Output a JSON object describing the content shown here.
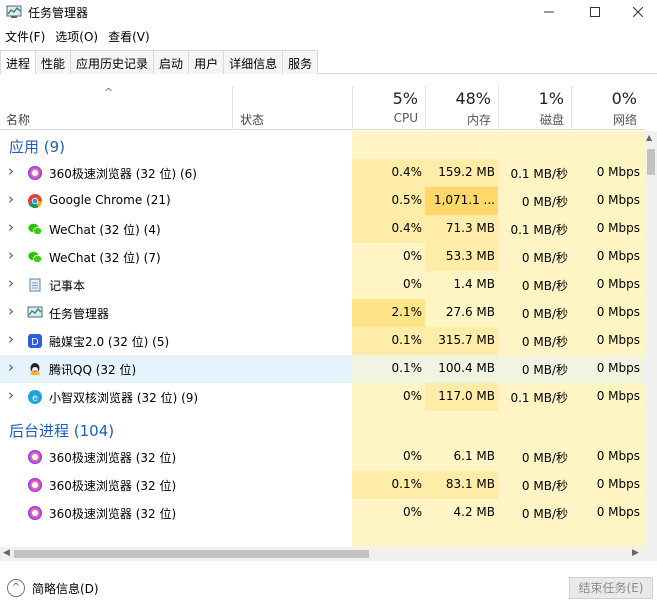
{
  "window": {
    "title": "任务管理器"
  },
  "menu": [
    "文件(F)",
    "选项(O)",
    "查看(V)"
  ],
  "tabs": [
    "进程",
    "性能",
    "应用历史记录",
    "启动",
    "用户",
    "详细信息",
    "服务"
  ],
  "header": {
    "name": "名称",
    "status": "状态",
    "cpu": {
      "pct": "5%",
      "label": "CPU"
    },
    "memory": {
      "pct": "48%",
      "label": "内存"
    },
    "disk": {
      "pct": "1%",
      "label": "磁盘"
    },
    "network": {
      "pct": "0%",
      "label": "网络"
    }
  },
  "groups": {
    "apps": "应用 (9)",
    "background": "后台进程 (104)"
  },
  "apps": [
    {
      "icon": "360-browser-icon",
      "name": "360极速浏览器 (32 位) (6)",
      "cpu": "0.4%",
      "mem": "159.2 MB",
      "disk": "0.1 MB/秒",
      "net": "0 Mbps"
    },
    {
      "icon": "chrome-icon",
      "name": "Google Chrome (21)",
      "cpu": "0.5%",
      "mem": "1,071.1 ...",
      "disk": "0 MB/秒",
      "net": "0 Mbps"
    },
    {
      "icon": "wechat-icon",
      "name": "WeChat (32 位) (4)",
      "cpu": "0.4%",
      "mem": "71.3 MB",
      "disk": "0.1 MB/秒",
      "net": "0 Mbps"
    },
    {
      "icon": "wechat-icon",
      "name": "WeChat (32 位) (7)",
      "cpu": "0%",
      "mem": "53.3 MB",
      "disk": "0 MB/秒",
      "net": "0 Mbps"
    },
    {
      "icon": "notepad-icon",
      "name": "记事本",
      "cpu": "0%",
      "mem": "1.4 MB",
      "disk": "0 MB/秒",
      "net": "0 Mbps"
    },
    {
      "icon": "task-manager-icon",
      "name": "任务管理器",
      "cpu": "2.1%",
      "mem": "27.6 MB",
      "disk": "0 MB/秒",
      "net": "0 Mbps"
    },
    {
      "icon": "rongmeibao-icon",
      "name": "融媒宝2.0 (32 位) (5)",
      "cpu": "0.1%",
      "mem": "315.7 MB",
      "disk": "0 MB/秒",
      "net": "0 Mbps"
    },
    {
      "icon": "qq-icon",
      "name": "腾讯QQ (32 位)",
      "cpu": "0.1%",
      "mem": "100.4 MB",
      "disk": "0 MB/秒",
      "net": "0 Mbps"
    },
    {
      "icon": "xiaozhi-browser-icon",
      "name": "小智双核浏览器 (32 位) (9)",
      "cpu": "0%",
      "mem": "117.0 MB",
      "disk": "0.1 MB/秒",
      "net": "0 Mbps"
    }
  ],
  "background": [
    {
      "icon": "360-browser-icon",
      "name": "360极速浏览器 (32 位)",
      "cpu": "0%",
      "mem": "6.1 MB",
      "disk": "0 MB/秒",
      "net": "0 Mbps"
    },
    {
      "icon": "360-browser-icon",
      "name": "360极速浏览器 (32 位)",
      "cpu": "0.1%",
      "mem": "83.1 MB",
      "disk": "0 MB/秒",
      "net": "0 Mbps"
    },
    {
      "icon": "360-browser-icon",
      "name": "360极速浏览器 (32 位)",
      "cpu": "0%",
      "mem": "4.2 MB",
      "disk": "0 MB/秒",
      "net": "0 Mbps"
    }
  ],
  "footer": {
    "brief": "简略信息(D)",
    "end_task": "结束任务(E)"
  },
  "colors": {
    "accent": "#1e5fb5",
    "heat_light": "#fff4c4",
    "heat_medium": "#ffe89a",
    "selected": "#e5f3ff"
  }
}
